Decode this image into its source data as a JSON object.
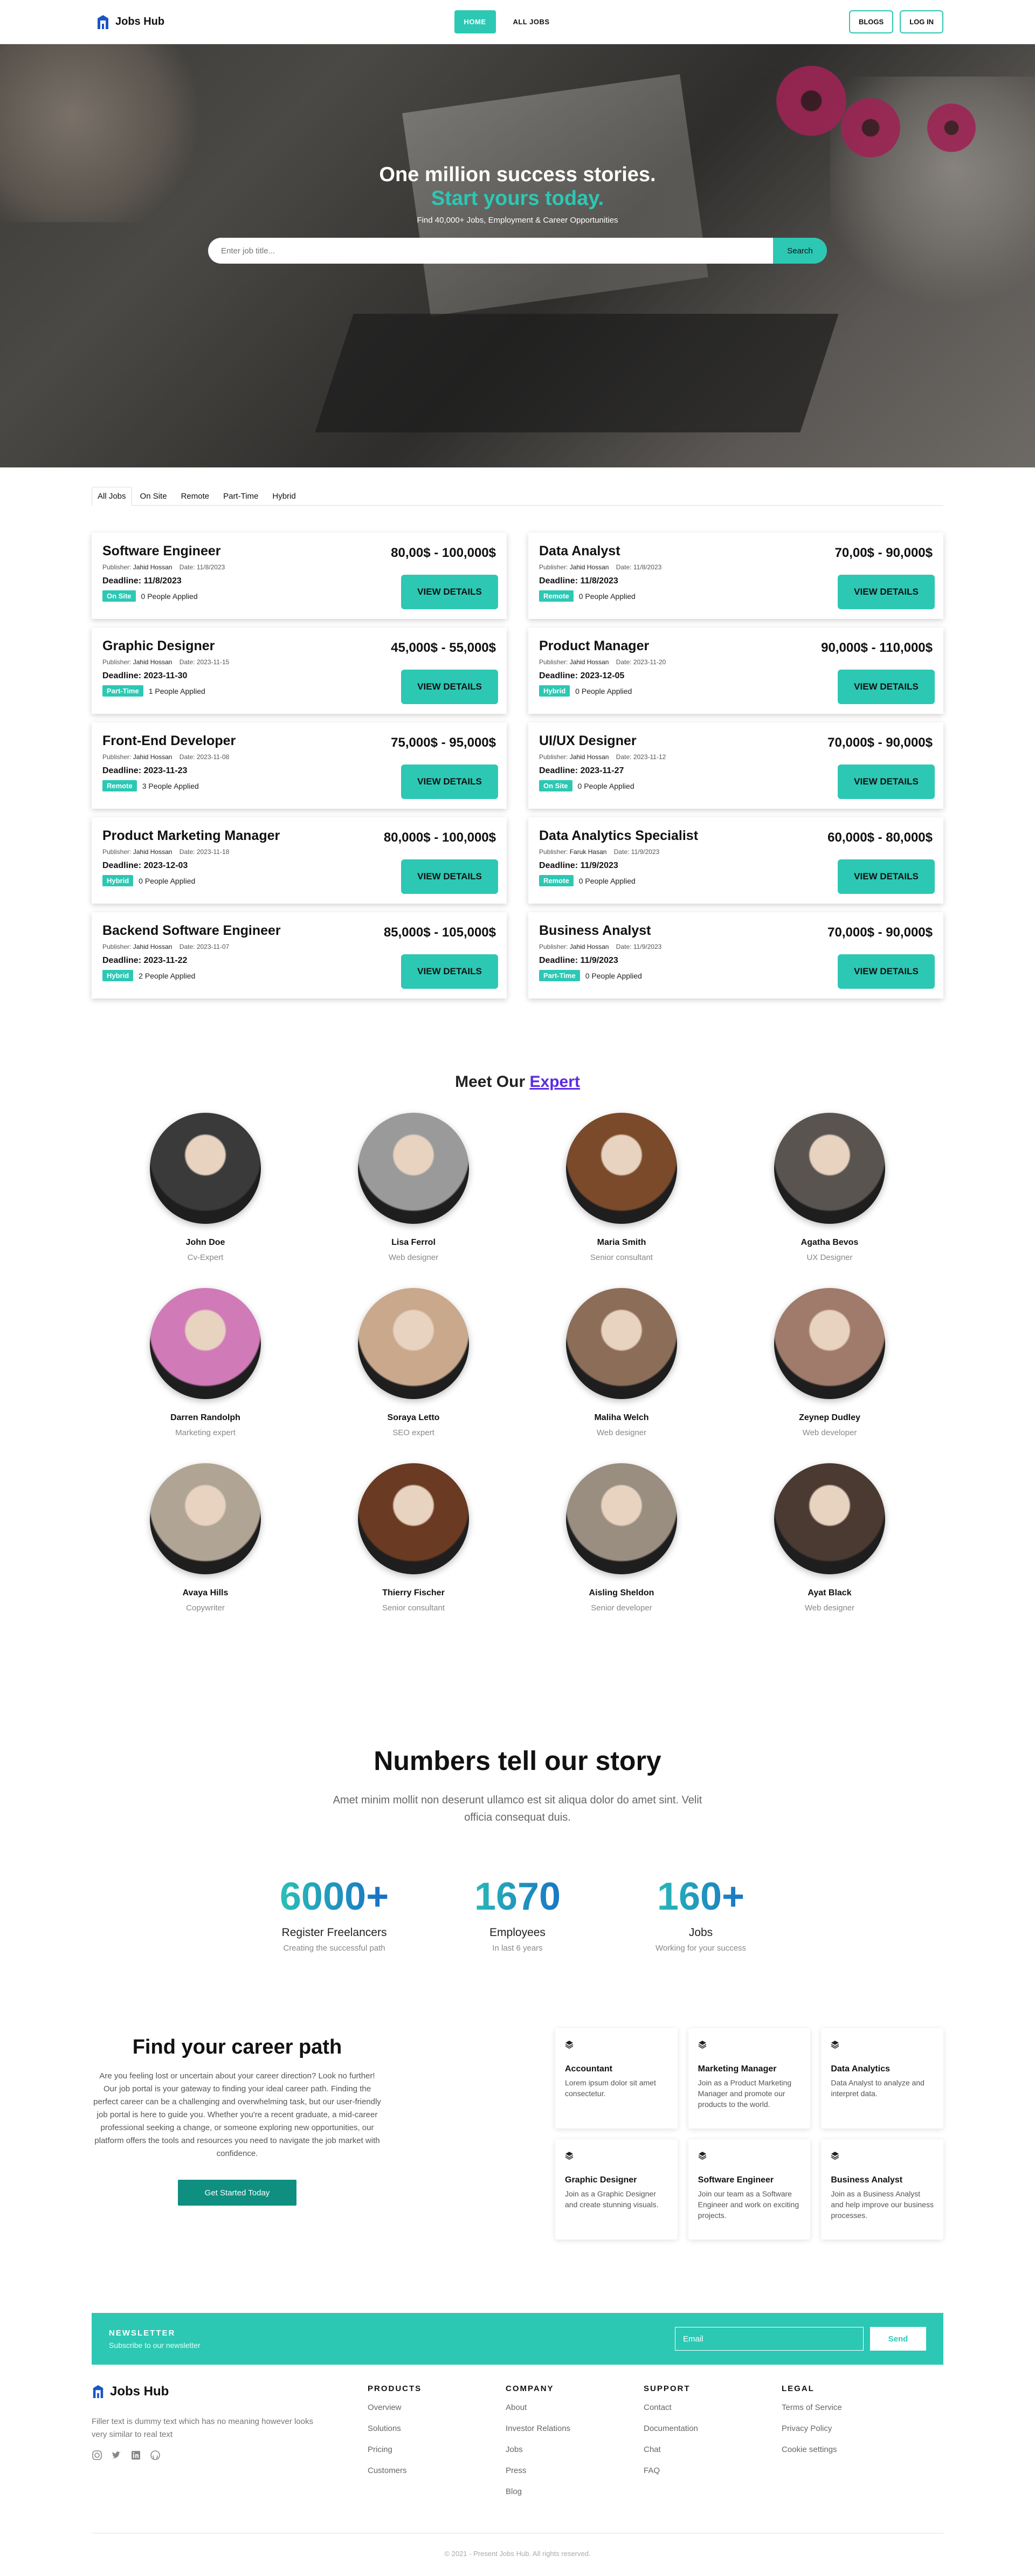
{
  "nav": {
    "brand": "Jobs Hub",
    "home": "HOME",
    "all_jobs": "ALL JOBS",
    "blogs": "BLOGS",
    "login": "LOG IN"
  },
  "hero": {
    "title": "One million success stories.",
    "subtitle": "Start yours today.",
    "tagline": "Find 40,000+ Jobs, Employment & Career Opportunities",
    "search_placeholder": "Enter job title...",
    "search_button": "Search"
  },
  "tabs": [
    "All Jobs",
    "On Site",
    "Remote",
    "Part-Time",
    "Hybrid"
  ],
  "job_labels": {
    "publisher": "Publisher:",
    "date": "Date:",
    "deadline": "Deadline:",
    "applied_suffix": "People Applied",
    "view_button": "VIEW DETAILS"
  },
  "jobs": [
    {
      "title": "Software Engineer",
      "publisher": "Jahid Hossan",
      "date": "11/8/2023",
      "deadline": "11/8/2023",
      "type": "On Site",
      "applied": "0",
      "salary": "80,00$ - 100,000$"
    },
    {
      "title": "Data Analyst",
      "publisher": "Jahid Hossan",
      "date": "11/8/2023",
      "deadline": "11/8/2023",
      "type": "Remote",
      "applied": "0",
      "salary": "70,00$ - 90,000$"
    },
    {
      "title": "Graphic Designer",
      "publisher": "Jahid Hossan",
      "date": "2023-11-15",
      "deadline": "2023-11-30",
      "type": "Part-Time",
      "applied": "1",
      "salary": "45,000$ - 55,000$"
    },
    {
      "title": "Product Manager",
      "publisher": "Jahid Hossan",
      "date": "2023-11-20",
      "deadline": "2023-12-05",
      "type": "Hybrid",
      "applied": "0",
      "salary": "90,000$ - 110,000$"
    },
    {
      "title": "Front-End Developer",
      "publisher": "Jahid Hossan",
      "date": "2023-11-08",
      "deadline": "2023-11-23",
      "type": "Remote",
      "applied": "3",
      "salary": "75,000$ - 95,000$"
    },
    {
      "title": "UI/UX Designer",
      "publisher": "Jahid Hossan",
      "date": "2023-11-12",
      "deadline": "2023-11-27",
      "type": "On Site",
      "applied": "0",
      "salary": "70,000$ - 90,000$"
    },
    {
      "title": "Product Marketing Manager",
      "publisher": "Jahid Hossan",
      "date": "2023-11-18",
      "deadline": "2023-12-03",
      "type": "Hybrid",
      "applied": "0",
      "salary": "80,000$ - 100,000$"
    },
    {
      "title": "Data Analytics Specialist",
      "publisher": "Faruk Hasan",
      "date": "11/9/2023",
      "deadline": "11/9/2023",
      "type": "Remote",
      "applied": "0",
      "salary": "60,000$ - 80,000$"
    },
    {
      "title": "Backend Software Engineer",
      "publisher": "Jahid Hossan",
      "date": "2023-11-07",
      "deadline": "2023-11-22",
      "type": "Hybrid",
      "applied": "2",
      "salary": "85,000$ - 105,000$"
    },
    {
      "title": "Business Analyst",
      "publisher": "Jahid Hossan",
      "date": "11/9/2023",
      "deadline": "11/9/2023",
      "type": "Part-Time",
      "applied": "0",
      "salary": "70,000$ - 90,000$"
    }
  ],
  "experts_section": {
    "title_prefix": "Meet Our",
    "title_link": "Expert"
  },
  "experts": [
    {
      "name": "John Doe",
      "role": "Cv-Expert",
      "tone": "#3a3a3a"
    },
    {
      "name": "Lisa Ferrol",
      "role": "Web designer",
      "tone": "#9a9a9a"
    },
    {
      "name": "Maria Smith",
      "role": "Senior consultant",
      "tone": "#7a4a2a"
    },
    {
      "name": "Agatha Bevos",
      "role": "UX Designer",
      "tone": "#5a5450"
    },
    {
      "name": "Darren Randolph",
      "role": "Marketing expert",
      "tone": "#d07ab8"
    },
    {
      "name": "Soraya Letto",
      "role": "SEO expert",
      "tone": "#c9a88c"
    },
    {
      "name": "Maliha Welch",
      "role": "Web designer",
      "tone": "#8c6e58"
    },
    {
      "name": "Zeynep Dudley",
      "role": "Web developer",
      "tone": "#a07a6a"
    },
    {
      "name": "Avaya Hills",
      "role": "Copywriter",
      "tone": "#b0a494"
    },
    {
      "name": "Thierry Fischer",
      "role": "Senior consultant",
      "tone": "#6a3a22"
    },
    {
      "name": "Aisling Sheldon",
      "role": "Senior developer",
      "tone": "#9a8e80"
    },
    {
      "name": "Ayat Black",
      "role": "Web designer",
      "tone": "#4a3a32"
    }
  ],
  "story": {
    "title": "Numbers tell our story",
    "text": "Amet minim mollit non deserunt ullamco est sit aliqua dolor do amet sint. Velit officia consequat duis."
  },
  "stats": [
    {
      "num": "6000+",
      "label": "Register Freelancers",
      "sub": "Creating the successful path"
    },
    {
      "num": "1670",
      "label": "Employees",
      "sub": "In last 6 years"
    },
    {
      "num": "160+",
      "label": "Jobs",
      "sub": "Working for your success"
    }
  ],
  "career": {
    "title": "Find your career path",
    "text": "Are you feeling lost or uncertain about your career direction? Look no further! Our job portal is your gateway to finding your ideal career path. Finding the perfect career can be a challenging and overwhelming task, but our user-friendly job portal is here to guide you. Whether you're a recent graduate, a mid-career professional seeking a change, or someone exploring new opportunities, our platform offers the tools and resources you need to navigate the job market with confidence.",
    "button": "Get Started Today"
  },
  "career_cards": [
    {
      "title": "Accountant",
      "text": "Lorem ipsum dolor sit amet consectetur."
    },
    {
      "title": "Marketing Manager",
      "text": "Join as a Product Marketing Manager and promote our products to the world."
    },
    {
      "title": "Data Analytics",
      "text": "Data Analyst to analyze and interpret data."
    },
    {
      "title": "Graphic Designer",
      "text": "Join as a Graphic Designer and create stunning visuals."
    },
    {
      "title": "Software Engineer",
      "text": "Join our team as a Software Engineer and work on exciting projects."
    },
    {
      "title": "Business Analyst",
      "text": "Join as a Business Analyst and help improve our business processes."
    }
  ],
  "newsletter": {
    "title": "NEWSLETTER",
    "subtitle": "Subscribe to our newsletter",
    "placeholder": "Email",
    "button": "Send"
  },
  "footer": {
    "brand": "Jobs Hub",
    "desc": "Filler text is dummy text which has no meaning however looks very similar to real text",
    "columns": [
      {
        "title": "PRODUCTS",
        "items": [
          "Overview",
          "Solutions",
          "Pricing",
          "Customers"
        ]
      },
      {
        "title": "COMPANY",
        "items": [
          "About",
          "Investor Relations",
          "Jobs",
          "Press",
          "Blog"
        ]
      },
      {
        "title": "SUPPORT",
        "items": [
          "Contact",
          "Documentation",
          "Chat",
          "FAQ"
        ]
      },
      {
        "title": "LEGAL",
        "items": [
          "Terms of Service",
          "Privacy Policy",
          "Cookie settings"
        ]
      }
    ],
    "copyright": "© 2021 - Present Jobs Hub. All rights reserved."
  }
}
